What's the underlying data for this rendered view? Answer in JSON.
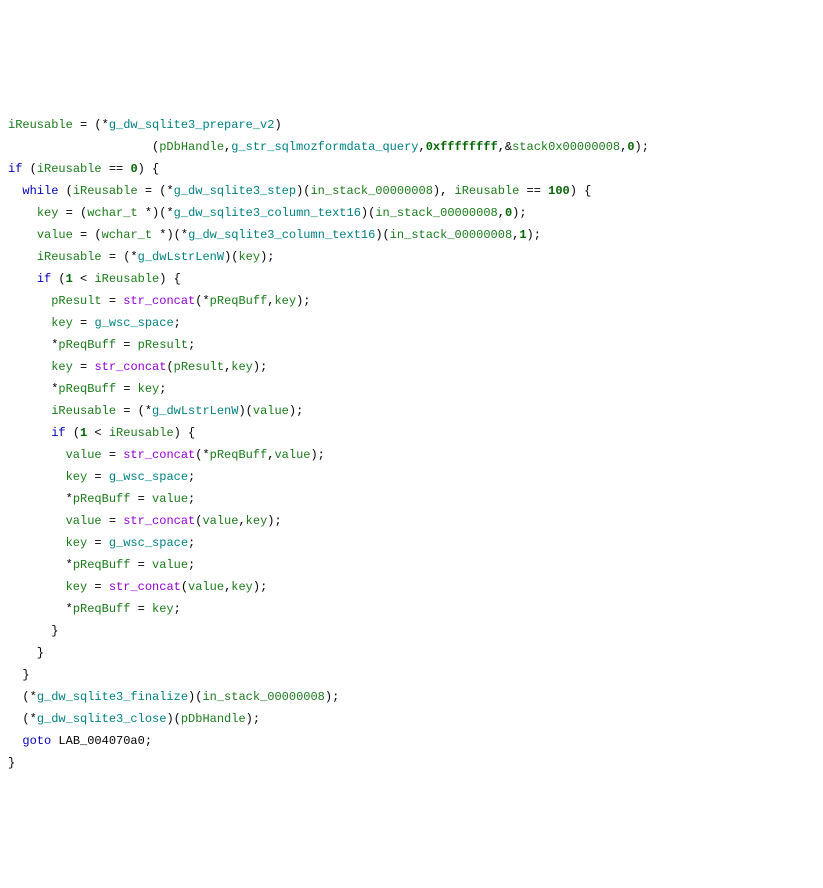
{
  "g": {
    "prepare": "g_dw_sqlite3_prepare_v2",
    "step": "g_dw_sqlite3_step",
    "col16": "g_dw_sqlite3_column_text16",
    "lstrlen": "g_dwLstrLenW",
    "space": "g_wsc_space",
    "finalize": "g_dw_sqlite3_finalize",
    "close": "g_dw_sqlite3_close",
    "query": "g_str_sqlmozformdata_query"
  },
  "v": {
    "iReusable": "iReusable",
    "pDbHandle": "pDbHandle",
    "stack8a": "stack0x00000008",
    "in_stack8": "in_stack_00000008",
    "key": "key",
    "value": "value",
    "pResult": "pResult",
    "pReqBuff": "pReqBuff",
    "wchar_t": "wchar_t"
  },
  "n": {
    "hexF": "0xffffffff",
    "z": "0",
    "one": "1",
    "hundred": "100"
  },
  "f": {
    "str_concat": "str_concat"
  },
  "lbl": {
    "lab": "LAB_004070a0"
  },
  "kw": {
    "if": "if",
    "while": "while",
    "goto": "goto"
  }
}
